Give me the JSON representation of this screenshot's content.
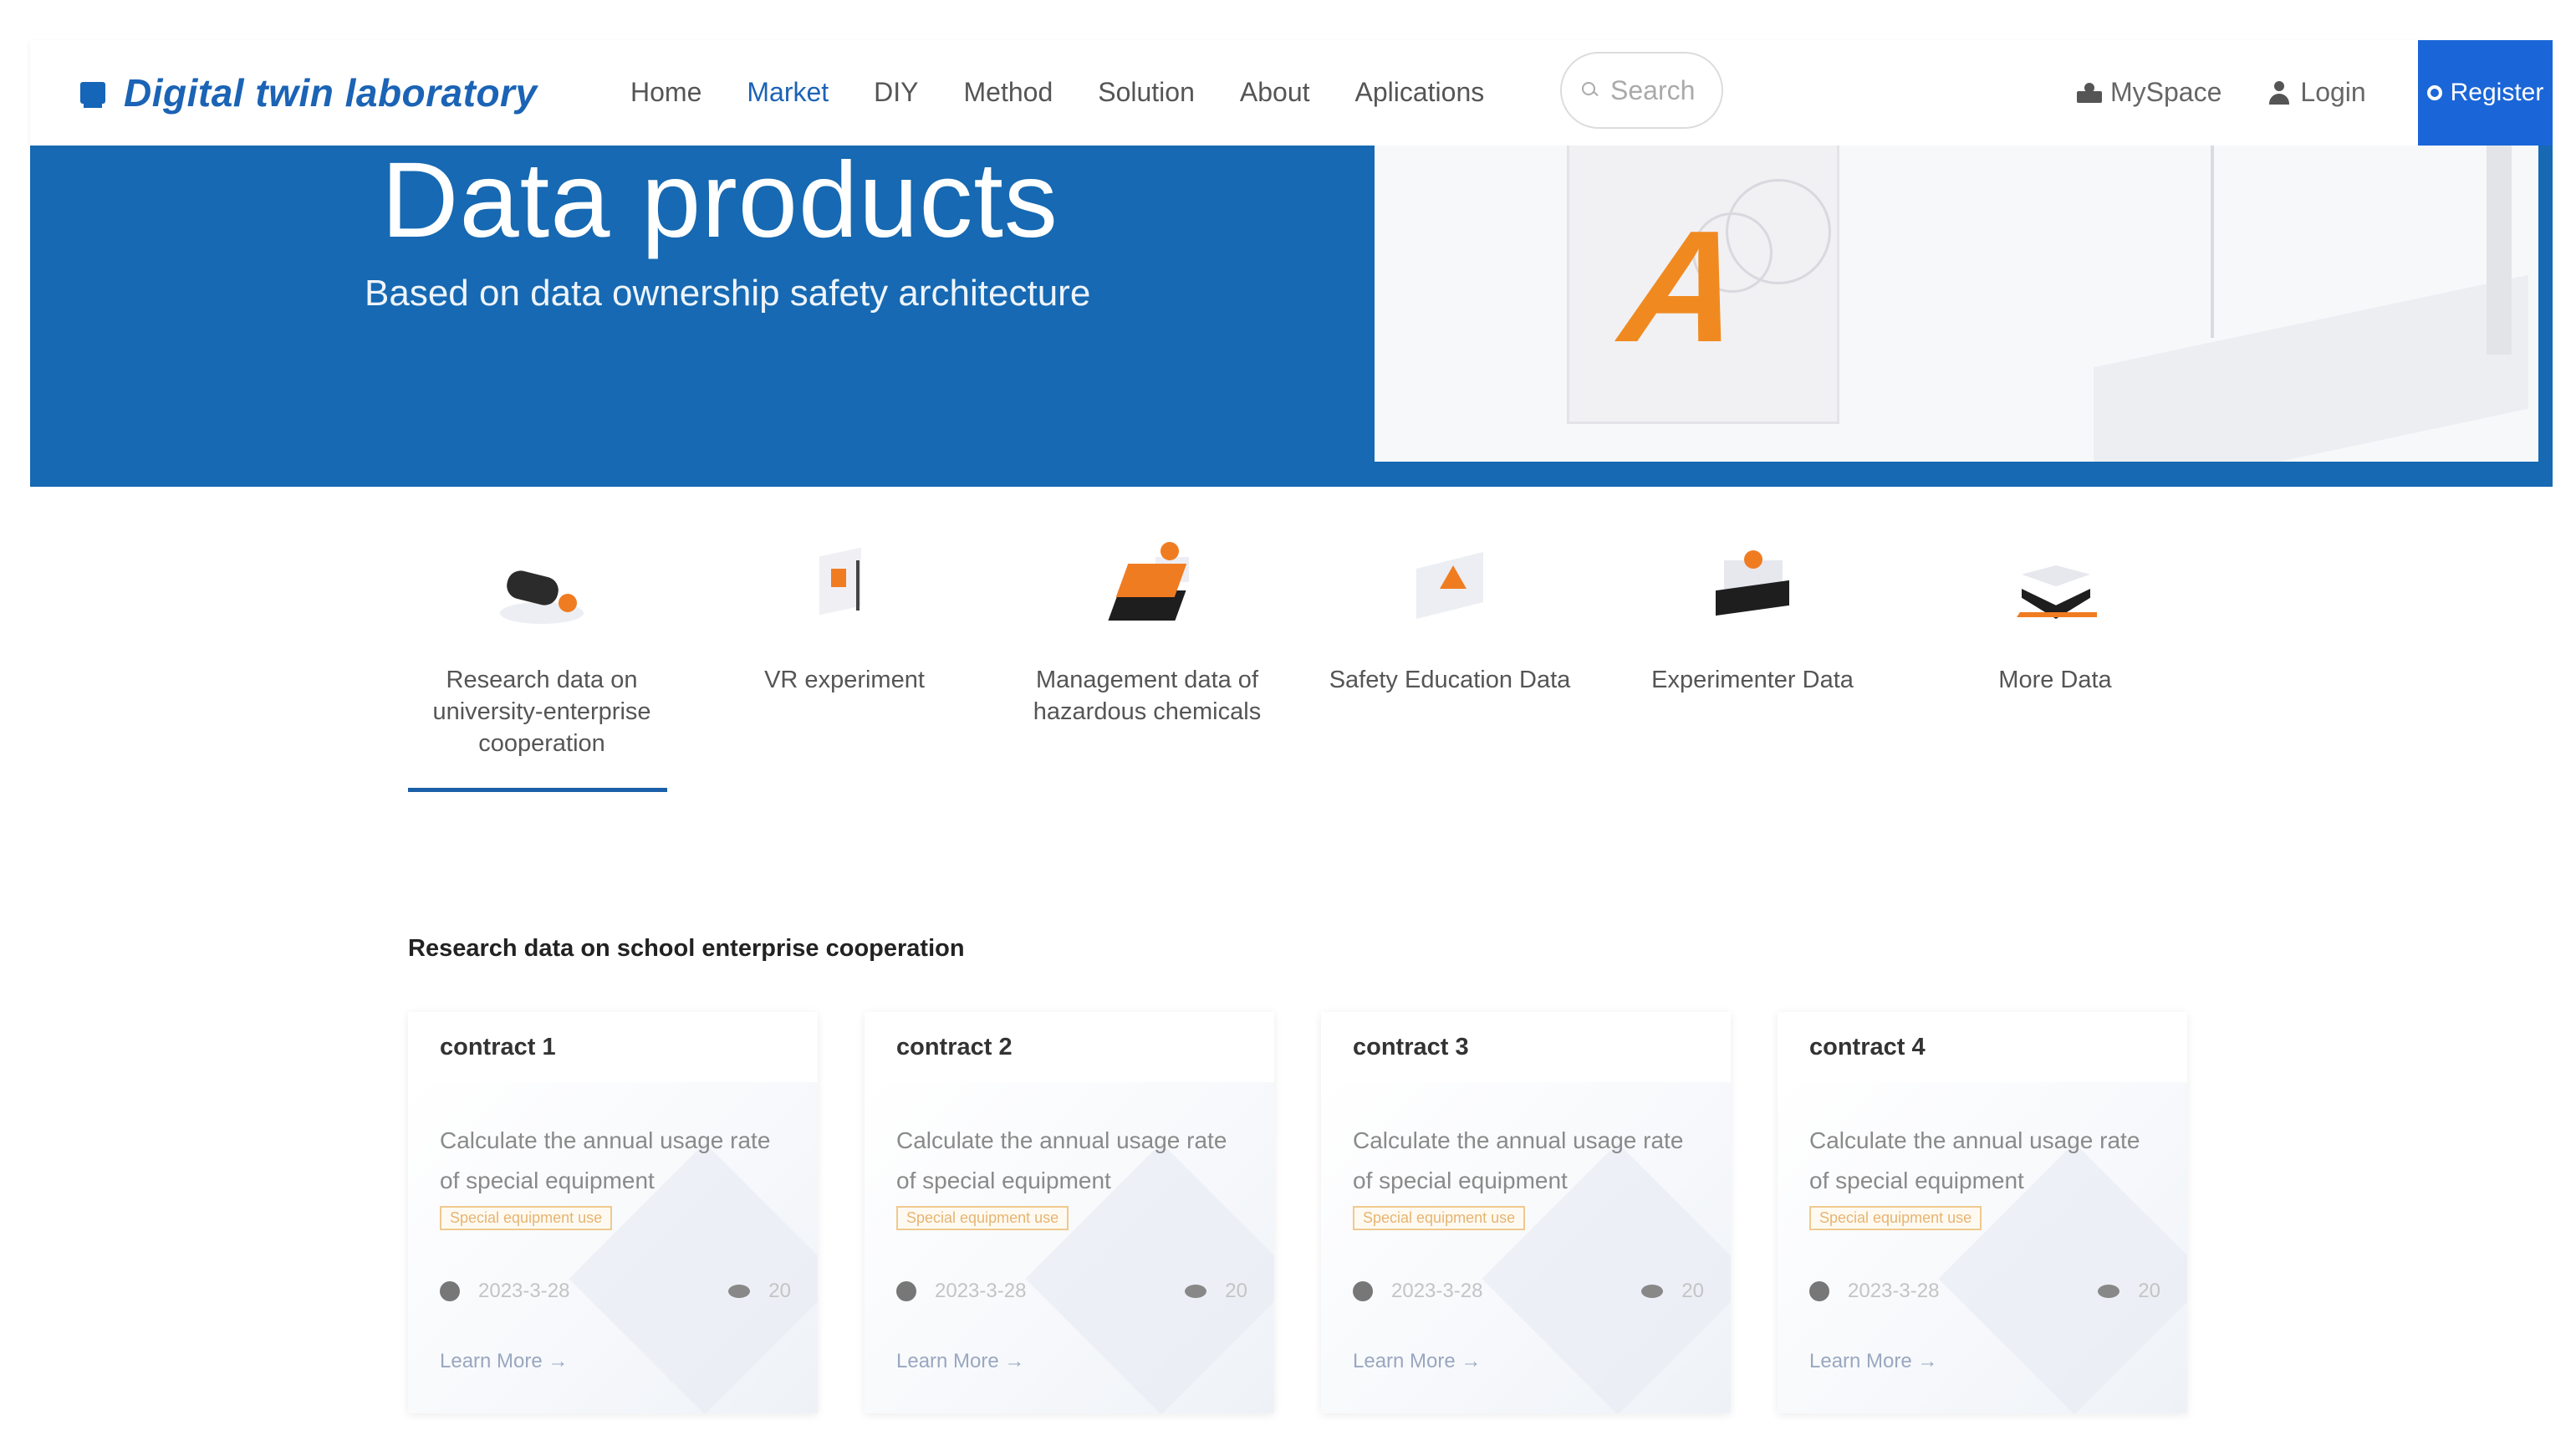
{
  "header": {
    "logo_text": "Digital twin laboratory",
    "nav": [
      {
        "label": "Home",
        "active": false
      },
      {
        "label": "Market",
        "active": true
      },
      {
        "label": "DIY",
        "active": false
      },
      {
        "label": "Method",
        "active": false
      },
      {
        "label": "Solution",
        "active": false
      },
      {
        "label": "About",
        "active": false
      },
      {
        "label": "Aplications",
        "active": false
      }
    ],
    "search_placeholder": "Search",
    "myspace_label": "MySpace",
    "login_label": "Login",
    "register_label": "Register"
  },
  "banner": {
    "title": "Data products",
    "subtitle": "Based on data ownership safety architecture"
  },
  "categories": [
    {
      "label": "Research data on university-enterprise cooperation",
      "icon": "research-data-icon",
      "selected": true
    },
    {
      "label": "VR experiment",
      "icon": "vr-experiment-icon",
      "selected": false
    },
    {
      "label": "Management data of hazardous chemicals",
      "icon": "hazardous-chemicals-icon",
      "selected": false
    },
    {
      "label": "Safety Education Data",
      "icon": "safety-education-icon",
      "selected": false
    },
    {
      "label": "Experimenter Data",
      "icon": "experimenter-data-icon",
      "selected": false
    },
    {
      "label": "More Data",
      "icon": "more-data-icon",
      "selected": false
    }
  ],
  "section": {
    "title": "Research data on school enterprise cooperation"
  },
  "cards": [
    {
      "title": "contract 1",
      "desc": "Calculate the annual usage rate of special equipment",
      "tag": "Special equipment use",
      "date": "2023-3-28",
      "views": "20",
      "more": "Learn More →"
    },
    {
      "title": "contract 2",
      "desc": "Calculate the annual usage rate of special equipment",
      "tag": "Special equipment use",
      "date": "2023-3-28",
      "views": "20",
      "more": "Learn More →"
    },
    {
      "title": "contract 3",
      "desc": "Calculate the annual usage rate of special equipment",
      "tag": "Special equipment use",
      "date": "2023-3-28",
      "views": "20",
      "more": "Learn More →"
    },
    {
      "title": "contract 4",
      "desc": "Calculate the annual usage rate of special equipment",
      "tag": "Special equipment use",
      "date": "2023-3-28",
      "views": "20",
      "more": "Learn More →"
    }
  ],
  "colors": {
    "brand_blue": "#1669b2",
    "register_blue": "#1a66d8",
    "accent_orange": "#f07c22",
    "active_nav": "#1b63b5"
  }
}
